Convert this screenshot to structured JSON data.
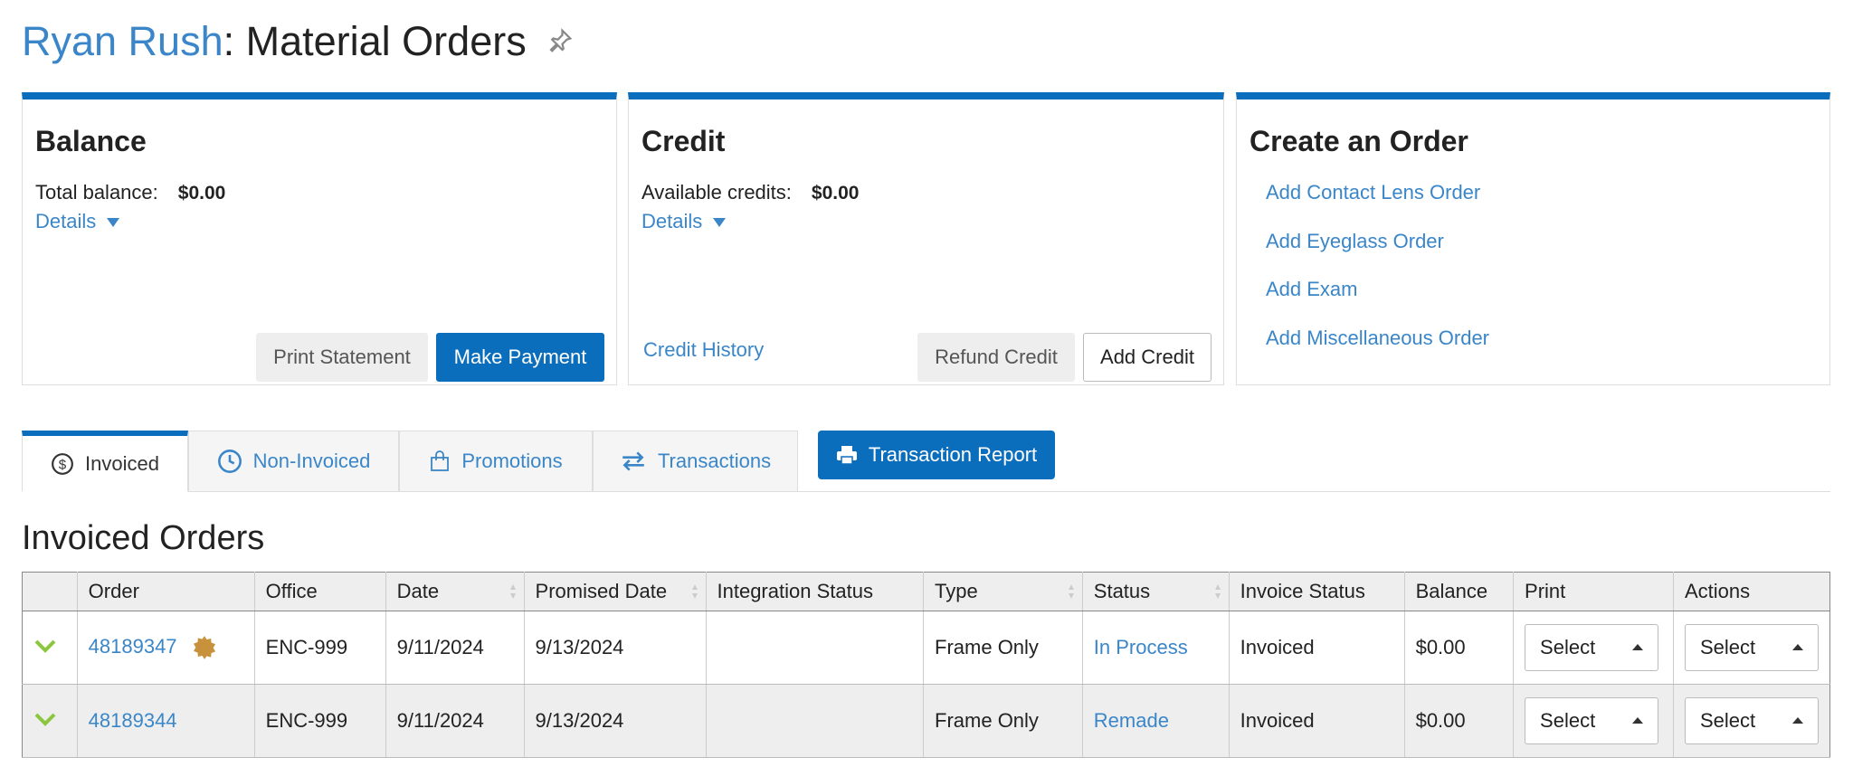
{
  "header": {
    "patient_name": "Ryan Rush",
    "separator": ": ",
    "page_title": "Material Orders"
  },
  "balance": {
    "title": "Balance",
    "label": "Total balance:",
    "value": "$0.00",
    "details": "Details",
    "print_statement": "Print Statement",
    "make_payment": "Make Payment"
  },
  "credit": {
    "title": "Credit",
    "label": "Available credits:",
    "value": "$0.00",
    "details": "Details",
    "history": "Credit History",
    "refund": "Refund Credit",
    "add": "Add Credit"
  },
  "create": {
    "title": "Create an Order",
    "links": [
      "Add Contact Lens Order",
      "Add Eyeglass Order",
      "Add Exam",
      "Add Miscellaneous Order"
    ]
  },
  "tabs": [
    {
      "label": "Invoiced"
    },
    {
      "label": "Non-Invoiced"
    },
    {
      "label": "Promotions"
    },
    {
      "label": "Transactions"
    }
  ],
  "transaction_report": "Transaction Report",
  "section_title": "Invoiced Orders",
  "table": {
    "headers": [
      "Order",
      "Office",
      "Date",
      "Promised Date",
      "Integration Status",
      "Type",
      "Status",
      "Invoice Status",
      "Balance",
      "Print",
      "Actions"
    ],
    "rows": [
      {
        "order": "48189347",
        "office": "ENC-999",
        "date": "9/11/2024",
        "promised": "9/13/2024",
        "integration": "",
        "type": "Frame Only",
        "status": "In Process",
        "invoice_status": "Invoiced",
        "balance": "$0.00",
        "print": "Select",
        "actions": "Select"
      },
      {
        "order": "48189344",
        "office": "ENC-999",
        "date": "9/11/2024",
        "promised": "9/13/2024",
        "integration": "",
        "type": "Frame Only",
        "status": "Remade",
        "invoice_status": "Invoiced",
        "balance": "$0.00",
        "print": "Select",
        "actions": "Select"
      }
    ]
  },
  "colors": {
    "primary": "#0a6ebd",
    "link": "#3a86c8",
    "check": "#8cc63f",
    "badge": "#c8913c"
  }
}
